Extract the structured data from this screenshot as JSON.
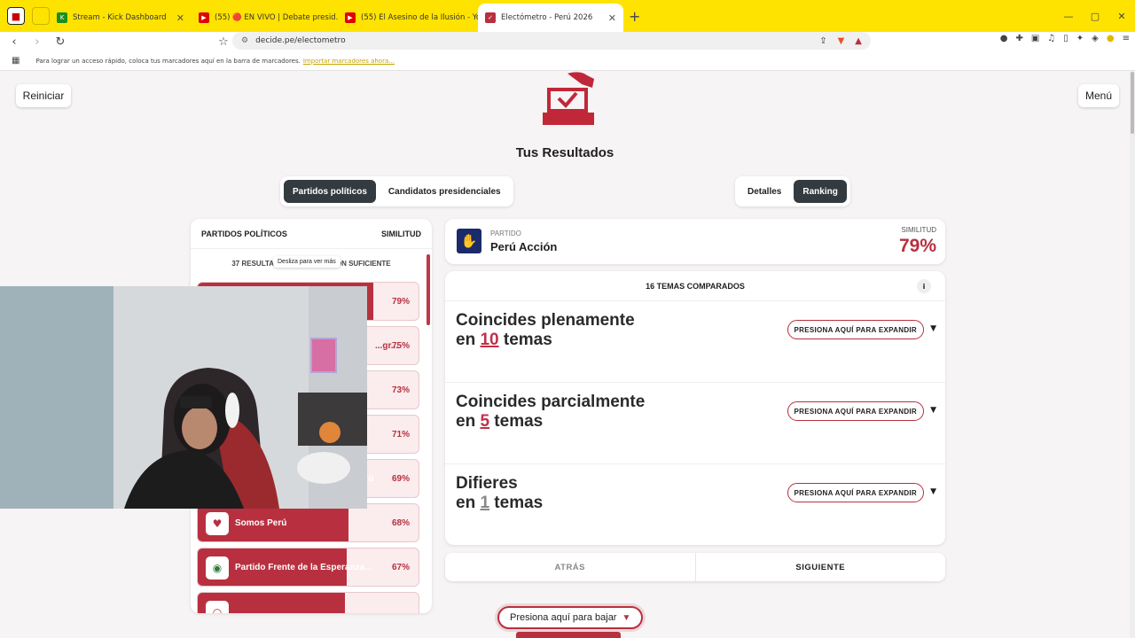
{
  "browser": {
    "tabs": [
      {
        "label": "Stream - Kick Dashboard",
        "color": "#1a8f1a",
        "glyph": "K"
      },
      {
        "label": "(55) 🔴 EN VIVO | Debate presid...",
        "color": "#e00000",
        "glyph": "▶"
      },
      {
        "label": "(55) El Asesino de la Ilusión - YouTube",
        "color": "#e00000",
        "glyph": "▶"
      },
      {
        "label": "Electómetro - Perú 2026",
        "color": "#b8303f",
        "glyph": "✓"
      }
    ],
    "url": "decide.pe/electometro",
    "bookmarks_text": "Para lograr un acceso rápido, coloca tus marcadores aquí en la barra de marcadores.",
    "bookmarks_link": "Importar marcadores ahora..."
  },
  "page": {
    "reset_label": "Reiniciar",
    "menu_label": "Menú",
    "title": "Tus Resultados",
    "tabs": [
      {
        "label": "Partidos políticos",
        "active": true
      },
      {
        "label": "Candidatos presidenciales",
        "active": false
      }
    ],
    "views": [
      {
        "label": "Detalles",
        "active": false
      },
      {
        "label": "Ranking",
        "active": true
      }
    ]
  },
  "list": {
    "header_left": "PARTIDOS POLÍTICOS",
    "header_right": "SIMILITUD",
    "subheader": "37 RESULTADOS · INFORMACIÓN SUFICIENTE",
    "tooltip": "Desliza para ver más",
    "rows": [
      {
        "name": "",
        "pct": "79%",
        "value": 79
      },
      {
        "name": "...gr...",
        "pct": "75%",
        "value": 75
      },
      {
        "name": "",
        "pct": "73%",
        "value": 73
      },
      {
        "name": "",
        "pct": "71%",
        "value": 71
      },
      {
        "name": "...rú",
        "pct": "69%",
        "value": 69
      },
      {
        "name": "Somos Perú",
        "pct": "68%",
        "value": 68
      },
      {
        "name": "Partido Frente de la Esperanza...",
        "pct": "67%",
        "value": 67
      }
    ]
  },
  "detail": {
    "kicker": "PARTIDO",
    "party_name": "Perú Acción",
    "similarity_label": "SIMILITUD",
    "similarity_value": "79%",
    "themes_header": "16 TEMAS COMPARADOS",
    "info_glyph": "i",
    "sections": [
      {
        "line1": "Coincides plenamente",
        "pre": "en ",
        "num": "10",
        "post": " temas",
        "button": "PRESIONA AQUÍ PARA EXPANDIR"
      },
      {
        "line1": "Coincides parcialmente",
        "pre": "en ",
        "num": "5",
        "post": " temas",
        "button": "PRESIONA AQUÍ PARA EXPANDIR"
      },
      {
        "line1": "Difieres",
        "pre": "en ",
        "num": "1",
        "post": " temas",
        "button": "PRESIONA AQUÍ PARA EXPANDIR"
      }
    ],
    "back_label": "ATRÁS",
    "next_label": "SIGUIENTE"
  },
  "scroll_button": "Presiona aquí para bajar",
  "colors": {
    "accent": "#b8303f",
    "dark": "#333a40",
    "chrome": "#ffe300"
  }
}
